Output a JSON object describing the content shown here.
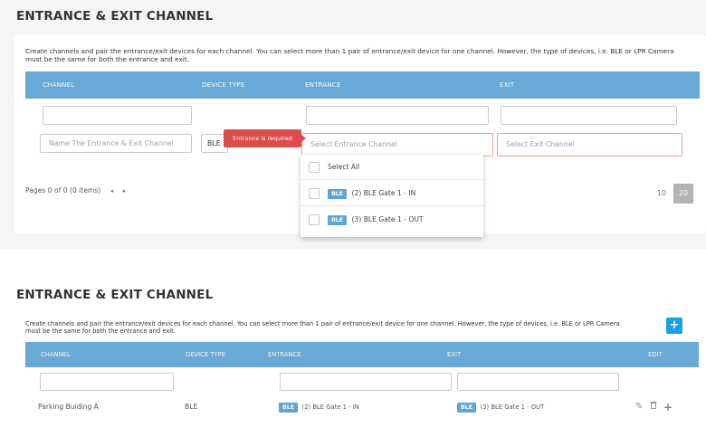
{
  "section1": {
    "title": "ENTRANCE & EXIT CHANNEL",
    "description_line1": "Create channels and pair the entrance/exit devices for each channel. You can select more than 1 pair of entrance/exit device for one channel. However, the type of devices, i.e. BLE or LPR Camera",
    "description_line2": "must be the same for both the entrance and exit.",
    "columns": [
      "CHANNEL",
      "DEVICE TYPE",
      "ENTRANCE",
      "EXIT"
    ],
    "new_row": {
      "channel_placeholder": "Name The Entrance & Exit Channel",
      "device_type_value": "BLE",
      "entrance_placeholder": "Select Entrance Channel",
      "exit_placeholder": "Select Exit Channel"
    },
    "error_tooltip": "Entrance is required",
    "dropdown": {
      "select_all": "Select All",
      "options": [
        {
          "badge": "BLE",
          "label": "(2) BLE Gate 1 - IN"
        },
        {
          "badge": "BLE",
          "label": "(3) BLE Gate 1 - OUT"
        }
      ]
    },
    "pager": {
      "summary": "Pages 0 of 0 (0 items)",
      "prev": "◂",
      "next": "▸",
      "size_options": [
        "10",
        "20"
      ],
      "selected_size": "20"
    }
  },
  "section2": {
    "title": "ENTRANCE & EXIT CHANNEL",
    "description_line1": "Create channels and pair the entrance/exit devices for each channel. You can select more than 1 pair of entrance/exit device for one channel. However, the type of devices, i.e. BLE or LPR Camera",
    "description_line2": "must be the same for both the entrance and exit.",
    "add_label": "+",
    "columns": [
      "CHANNEL",
      "DEVICE TYPE",
      "ENTRANCE",
      "EXIT",
      "EDIT"
    ],
    "rows": [
      {
        "channel": "Parking Buiding A",
        "device_type": "BLE",
        "entrance_badge": "BLE",
        "entrance": "(2) BLE Gate 1 - IN",
        "exit_badge": "BLE",
        "exit": "(3) BLE Gate 1 - OUT"
      }
    ],
    "actions": {
      "edit": "✎",
      "delete": "🗑",
      "add": "+"
    }
  },
  "colors": {
    "header_blue": "#68a9d6",
    "badge_blue": "#5fa4d8",
    "error_red": "#db4d4b",
    "add_button": "#17a0e6"
  },
  "icons": [
    "pencil-icon",
    "trash-icon",
    "plus-icon",
    "chevron-left-icon",
    "chevron-right-icon"
  ]
}
